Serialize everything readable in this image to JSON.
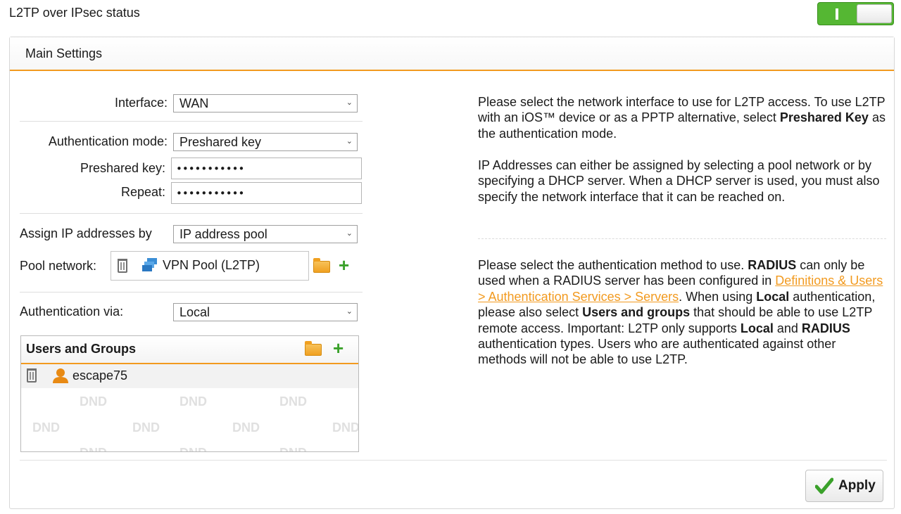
{
  "status": {
    "title": "L2TP over IPsec status",
    "enabled": true
  },
  "panel": {
    "title": "Main Settings"
  },
  "form": {
    "interface": {
      "label": "Interface:",
      "value": "WAN"
    },
    "auth_mode": {
      "label": "Authentication mode:",
      "value": "Preshared key"
    },
    "preshared_key": {
      "label": "Preshared key:",
      "value": "•••••••••••"
    },
    "repeat": {
      "label": "Repeat:",
      "value": "•••••••••••"
    },
    "assign_ip": {
      "label": "Assign IP addresses by",
      "value": "IP address pool"
    },
    "pool_network": {
      "label": "Pool network:",
      "value": "VPN Pool (L2TP)"
    },
    "auth_via": {
      "label": "Authentication via:",
      "value": "Local"
    }
  },
  "users_groups": {
    "title": "Users and Groups",
    "items": [
      {
        "name": "escape75"
      }
    ],
    "watermark": "DND"
  },
  "help": {
    "p1_a": "Please select the network interface to use for L2TP access. To use L2TP with an iOS™ device or as a PPTP alternative, select ",
    "p1_b": "Preshared Key",
    "p1_c": " as the authentication mode.",
    "p2": "IP Addresses can either be assigned by selecting a pool network or by specifying a DHCP server. When a DHCP server is used, you must also specify the network interface that it can be reached on.",
    "p3_a": "Please select the authentication method to use. ",
    "p3_b": "RADIUS",
    "p3_c": " can only be used when a RADIUS server has been configured in ",
    "p3_link": "Definitions & Users > Authentication Services > Servers",
    "p3_d": ". When using ",
    "p3_e": "Local",
    "p3_f": " authentication, please also select ",
    "p3_g": "Users and groups",
    "p3_h": " that should be able to use L2TP remote access. Important: L2TP only supports ",
    "p3_i": "Local",
    "p3_j": " and ",
    "p3_k": "RADIUS",
    "p3_l": " authentication types. Users who are authenticated against other methods will not be able to use L2TP."
  },
  "actions": {
    "apply": "Apply"
  },
  "colors": {
    "accent": "#f29a1f",
    "toggle_on": "#55b733",
    "add": "#3aa12a"
  },
  "icons": [
    "trash-icon",
    "network-pool-icon",
    "folder-icon",
    "plus-icon",
    "user-icon",
    "check-icon"
  ]
}
